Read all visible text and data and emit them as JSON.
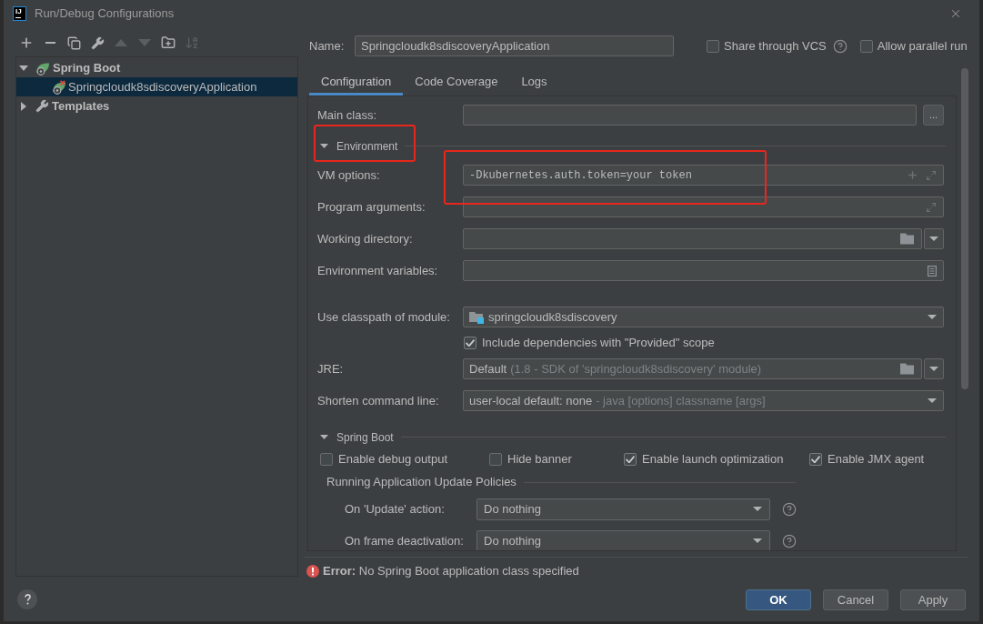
{
  "window": {
    "logo_text": "IJ",
    "title": "Run/Debug Configurations"
  },
  "toolbar": [
    {
      "kind": "add",
      "disabled": false
    },
    {
      "kind": "remove",
      "disabled": false
    },
    {
      "kind": "copy",
      "disabled": false
    },
    {
      "kind": "edit-templates",
      "disabled": false
    },
    {
      "kind": "move-up",
      "disabled": true
    },
    {
      "kind": "move-down",
      "disabled": true
    },
    {
      "kind": "new-folder",
      "disabled": false
    },
    {
      "kind": "sort",
      "disabled": true
    }
  ],
  "tree": [
    {
      "kind": "spring",
      "label": "Spring Boot",
      "expanded": true,
      "selected": false,
      "children": [
        {
          "kind": "spring-error",
          "label": "Springcloudk8sdiscoveryApplication",
          "selected": true
        }
      ]
    },
    {
      "kind": "templates",
      "label": "Templates",
      "expanded": false,
      "selected": false
    }
  ],
  "name": {
    "label": "Name:",
    "value": "Springcloudk8sdiscoveryApplication"
  },
  "options": [
    {
      "label": "Share through VCS",
      "checked": false,
      "help": true
    },
    {
      "label": "Allow parallel run",
      "checked": false,
      "help": false
    }
  ],
  "tabs": [
    {
      "label": "Configuration",
      "selected": true
    },
    {
      "label": "Code Coverage",
      "selected": false
    },
    {
      "label": "Logs",
      "selected": false
    }
  ],
  "form": [
    {
      "kind": "text-field",
      "label": "Main class:",
      "browse_button": "...",
      "highlighted": false
    },
    {
      "kind": "section",
      "label": "Environment",
      "expanded": true,
      "highlighted": true,
      "rows": [
        {
          "kind": "code-field",
          "label": "VM options:",
          "value": "-Dkubernetes.auth.token=your token",
          "icons": [
            {
              "kind": "plus"
            },
            {
              "kind": "expand"
            }
          ],
          "highlighted": true
        },
        {
          "kind": "text-field",
          "label": "Program arguments:",
          "icons": [
            {
              "kind": "expand"
            }
          ],
          "highlighted": false
        },
        {
          "kind": "text-field",
          "label": "Working directory:",
          "icons": [
            {
              "kind": "folder"
            }
          ],
          "dropdown": {
            "kind": "button"
          },
          "highlighted": false
        },
        {
          "kind": "text-field",
          "label": "Environment variables:",
          "icons": [
            {
              "kind": "list"
            }
          ],
          "highlighted": false
        }
      ]
    },
    {
      "kind": "combo",
      "label": "Use classpath of module:",
      "value_icon": {
        "kind": "module"
      },
      "value": "springcloudk8sdiscovery",
      "dropdown": {
        "kind": "inline"
      },
      "highlighted": false
    },
    {
      "kind": "checkbox",
      "label": "Include dependencies with \"Provided\" scope",
      "checked": true,
      "highlighted": false
    },
    {
      "kind": "combo",
      "label": "JRE:",
      "value": "Default",
      "detail": "(1.8 - SDK of 'springcloudk8sdiscovery' module)",
      "icons": [
        {
          "kind": "folder"
        }
      ],
      "dropdown": {
        "kind": "button"
      },
      "highlighted": false
    },
    {
      "kind": "combo",
      "label": "Shorten command line:",
      "value": "user-local default: none",
      "detail": "- java [options] classname [args]",
      "dropdown": {
        "kind": "inline"
      },
      "highlighted": false
    },
    {
      "kind": "section",
      "label": "Spring Boot",
      "expanded": true,
      "highlighted": false,
      "rows": [
        {
          "kind": "checkboxes",
          "items": [
            {
              "label": "Enable debug output",
              "checked": false
            },
            {
              "label": "Hide banner",
              "checked": false
            },
            {
              "label": "Enable launch optimization",
              "checked": true
            },
            {
              "label": "Enable JMX agent",
              "checked": true
            }
          ]
        },
        {
          "kind": "group",
          "label": "Running Application Update Policies",
          "rows": [
            {
              "kind": "policy",
              "label": "On 'Update' action:",
              "value": "Do nothing",
              "help": true
            },
            {
              "kind": "policy",
              "label": "On frame deactivation:",
              "value": "Do nothing",
              "help": true
            }
          ]
        }
      ]
    }
  ],
  "error": "**Error:** No Spring Boot application class specified",
  "buttons": [
    {
      "label": "OK",
      "default": true
    },
    {
      "label": "Cancel",
      "default": false
    },
    {
      "label": "Apply",
      "default": false
    }
  ]
}
